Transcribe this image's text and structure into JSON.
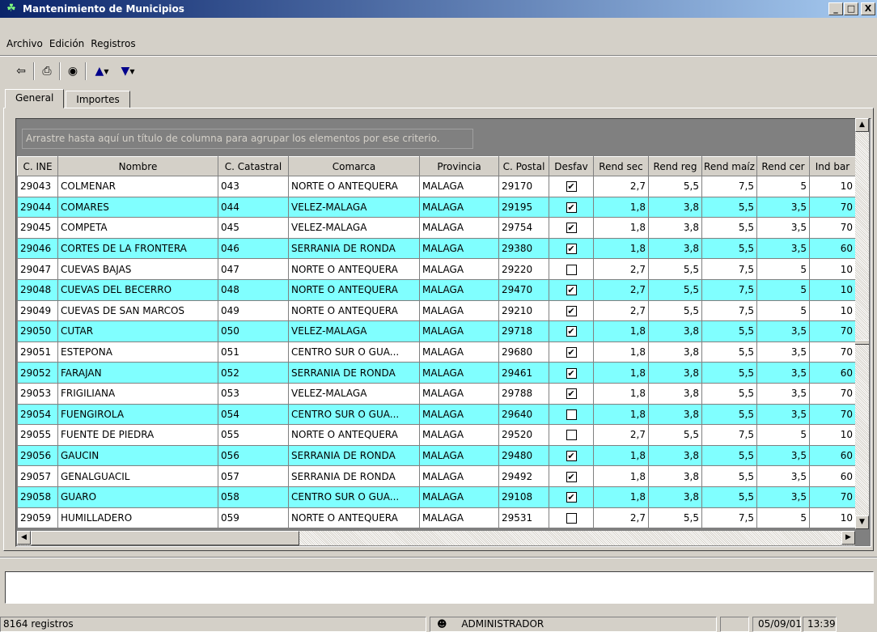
{
  "window": {
    "title": "Mantenimiento de Municipios",
    "buttons": [
      "_",
      "□",
      "X"
    ]
  },
  "menu": [
    "Archivo",
    "Edición",
    "Registros"
  ],
  "tabs": [
    "General",
    "Importes"
  ],
  "grid": {
    "group_hint": "Arrastre hasta aquí un título de columna para agrupar los elementos por ese criterio.",
    "columns": [
      "C. INE",
      "Nombre",
      "C. Catastral",
      "Comarca",
      "Provincia",
      "C. Postal",
      "Desfav",
      "Rend sec",
      "Rend reg",
      "Rend maíz",
      "Rend cer",
      "Ind bar"
    ],
    "rows": [
      [
        "29043",
        "COLMENAR",
        "043",
        "NORTE O ANTEQUERA",
        "MALAGA",
        "29170",
        true,
        "2,7",
        "5,5",
        "7,5",
        "5",
        "10"
      ],
      [
        "29044",
        "COMARES",
        "044",
        "VELEZ-MALAGA",
        "MALAGA",
        "29195",
        true,
        "1,8",
        "3,8",
        "5,5",
        "3,5",
        "70"
      ],
      [
        "29045",
        "COMPETA",
        "045",
        "VELEZ-MALAGA",
        "MALAGA",
        "29754",
        true,
        "1,8",
        "3,8",
        "5,5",
        "3,5",
        "70"
      ],
      [
        "29046",
        "CORTES DE LA FRONTERA",
        "046",
        "SERRANIA DE RONDA",
        "MALAGA",
        "29380",
        true,
        "1,8",
        "3,8",
        "5,5",
        "3,5",
        "60"
      ],
      [
        "29047",
        "CUEVAS BAJAS",
        "047",
        "NORTE O ANTEQUERA",
        "MALAGA",
        "29220",
        false,
        "2,7",
        "5,5",
        "7,5",
        "5",
        "10"
      ],
      [
        "29048",
        "CUEVAS DEL BECERRO",
        "048",
        "NORTE O ANTEQUERA",
        "MALAGA",
        "29470",
        true,
        "2,7",
        "5,5",
        "7,5",
        "5",
        "10"
      ],
      [
        "29049",
        "CUEVAS DE SAN MARCOS",
        "049",
        "NORTE O ANTEQUERA",
        "MALAGA",
        "29210",
        true,
        "2,7",
        "5,5",
        "7,5",
        "5",
        "10"
      ],
      [
        "29050",
        "CUTAR",
        "050",
        "VELEZ-MALAGA",
        "MALAGA",
        "29718",
        true,
        "1,8",
        "3,8",
        "5,5",
        "3,5",
        "70"
      ],
      [
        "29051",
        "ESTEPONA",
        "051",
        "CENTRO SUR O GUA...",
        "MALAGA",
        "29680",
        true,
        "1,8",
        "3,8",
        "5,5",
        "3,5",
        "70"
      ],
      [
        "29052",
        "FARAJAN",
        "052",
        "SERRANIA DE RONDA",
        "MALAGA",
        "29461",
        true,
        "1,8",
        "3,8",
        "5,5",
        "3,5",
        "60"
      ],
      [
        "29053",
        "FRIGILIANA",
        "053",
        "VELEZ-MALAGA",
        "MALAGA",
        "29788",
        true,
        "1,8",
        "3,8",
        "5,5",
        "3,5",
        "70"
      ],
      [
        "29054",
        "FUENGIROLA",
        "054",
        "CENTRO SUR O GUA...",
        "MALAGA",
        "29640",
        false,
        "1,8",
        "3,8",
        "5,5",
        "3,5",
        "70"
      ],
      [
        "29055",
        "FUENTE DE PIEDRA",
        "055",
        "NORTE O ANTEQUERA",
        "MALAGA",
        "29520",
        false,
        "2,7",
        "5,5",
        "7,5",
        "5",
        "10"
      ],
      [
        "29056",
        "GAUCIN",
        "056",
        "SERRANIA DE RONDA",
        "MALAGA",
        "29480",
        true,
        "1,8",
        "3,8",
        "5,5",
        "3,5",
        "60"
      ],
      [
        "29057",
        "GENALGUACIL",
        "057",
        "SERRANIA DE RONDA",
        "MALAGA",
        "29492",
        true,
        "1,8",
        "3,8",
        "5,5",
        "3,5",
        "60"
      ],
      [
        "29058",
        "GUARO",
        "058",
        "CENTRO SUR O GUA...",
        "MALAGA",
        "29108",
        true,
        "1,8",
        "3,8",
        "5,5",
        "3,5",
        "70"
      ],
      [
        "29059",
        "HUMILLADERO",
        "059",
        "NORTE O ANTEQUERA",
        "MALAGA",
        "29531",
        false,
        "2,7",
        "5,5",
        "7,5",
        "5",
        "10"
      ]
    ]
  },
  "status": {
    "records": "8164 registros",
    "user": "ADMINISTRADOR",
    "date": "05/09/01",
    "time": "13:39"
  },
  "colors": {
    "alt_row": "#80ffff",
    "title_start": "#0a246a",
    "title_end": "#a6caf0"
  }
}
